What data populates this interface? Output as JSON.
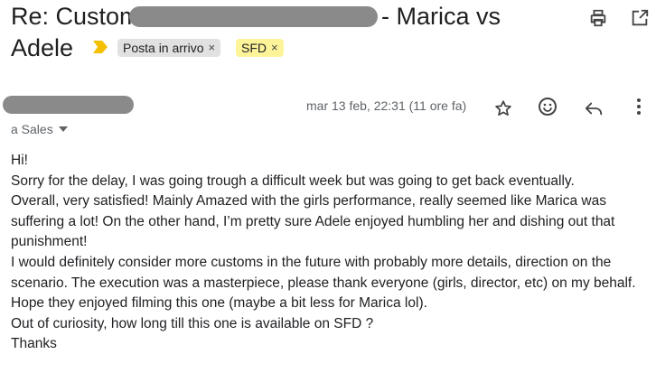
{
  "header": {
    "subject_prefix": "Re: Custom",
    "subject_suffix": "- Marica vs",
    "subject_line2": "Adele",
    "labels": [
      {
        "text": "Posta in arrivo",
        "close": "×",
        "bg": "#e1e1e1"
      },
      {
        "text": "SFD",
        "close": "×",
        "bg": "#fdf49a"
      }
    ],
    "importance_color": "#f4c000"
  },
  "message": {
    "date": "mar 13 feb, 22:31 (11 ore fa)",
    "to_label": "a Sales",
    "body": [
      "Hi!",
      "Sorry for the delay, I was going trough a difficult week but was going to get back eventually.",
      "Overall, very satisfied! Mainly Amazed with the girls performance, really seemed like Marica was suffering a lot! On the other hand, I’m pretty sure Adele enjoyed humbling her and dishing out that punishment!",
      "I would definitely consider more customs in the future with probably more details, direction on the scenario. The execution was a masterpiece, please thank everyone (girls, director, etc) on my behalf. Hope they enjoyed filming this one (maybe a bit less for Marica lol).",
      "Out of curiosity, how long till this one is available on SFD ?",
      "Thanks"
    ]
  },
  "icons": [
    "print-icon",
    "open-in-new-icon",
    "star-icon",
    "emoji-icon",
    "reply-icon",
    "more-vert-icon",
    "dropdown-icon",
    "importance-marker-icon"
  ]
}
